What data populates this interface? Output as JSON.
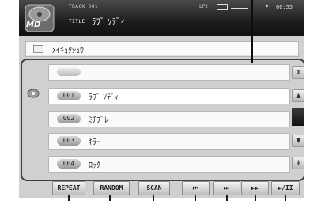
{
  "header": {
    "logo_text": "MD",
    "track_label": "TRACK 001",
    "title_label": "TITLE",
    "title_value": "ﾗﾌﾞ ｿﾃﾞｨ",
    "lp_label": "LP2",
    "time": "00:55",
    "icons": [
      "disc-logo-icon",
      "play-indicator-icon",
      "battery-icon"
    ]
  },
  "folder": {
    "name": "ﾒｲｷｮｸｼｭｳ"
  },
  "list": {
    "rows": [
      {
        "num": "",
        "name": ""
      },
      {
        "num": "001",
        "name": "ﾗﾌﾞ ｿﾃﾞｨ"
      },
      {
        "num": "002",
        "name": "ﾐﾁﾌﾞﾚ"
      },
      {
        "num": "003",
        "name": "ｷﾗｰ"
      },
      {
        "num": "004",
        "name": "ﾛｯｸ"
      }
    ],
    "selected_index": 1
  },
  "scroll": {
    "icons": [
      "page-up-icon",
      "up-arrow-icon",
      "down-arrow-icon",
      "page-down-icon"
    ]
  },
  "buttons": {
    "repeat": "REPEAT",
    "random": "RANDOM",
    "scan": "SCAN",
    "prev": "⏮",
    "next": "⏭",
    "ff": "▶▶",
    "playpause": "▶/II"
  }
}
